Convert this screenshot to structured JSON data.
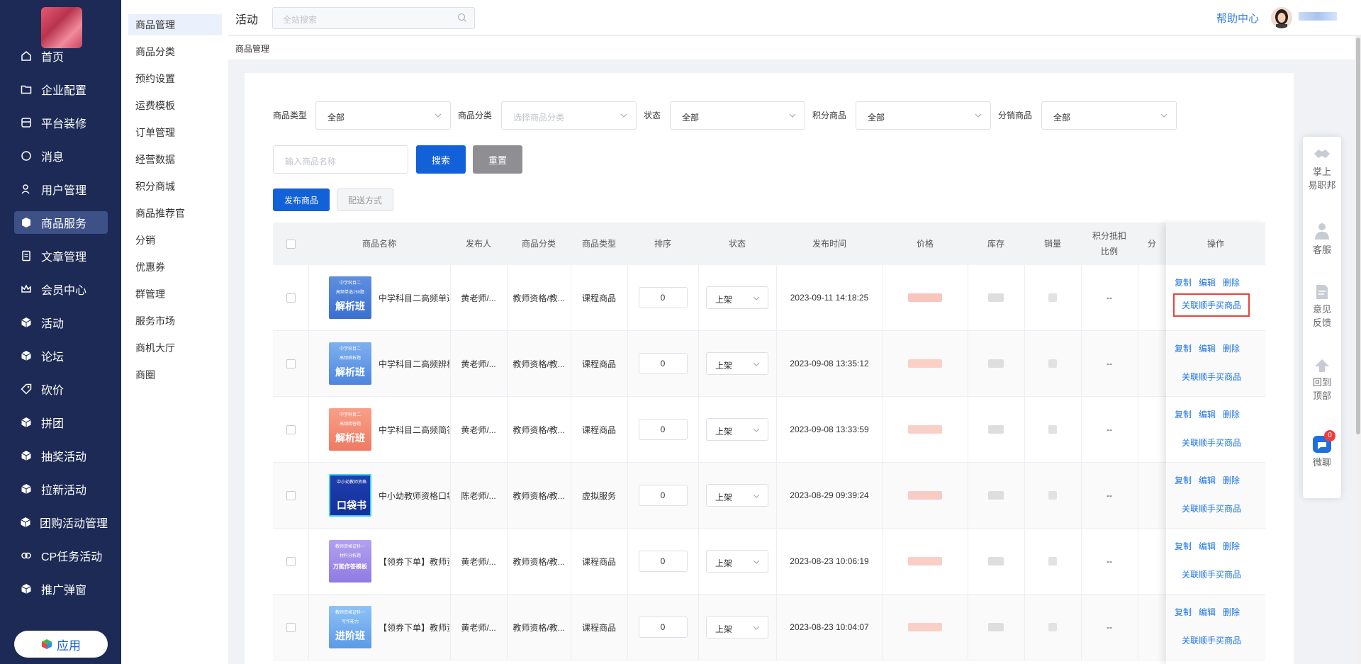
{
  "sidebar": {
    "items": [
      {
        "label": "首页",
        "icon": "home-icon"
      },
      {
        "label": "企业配置",
        "icon": "folder-icon"
      },
      {
        "label": "平台装修",
        "icon": "store-icon"
      },
      {
        "label": "消息",
        "icon": "chat-icon"
      },
      {
        "label": "用户管理",
        "icon": "user-icon"
      },
      {
        "label": "商品服务",
        "icon": "goods-icon",
        "active": true
      },
      {
        "label": "文章管理",
        "icon": "article-icon"
      },
      {
        "label": "会员中心",
        "icon": "crown-icon"
      },
      {
        "label": "活动",
        "icon": "cube-icon"
      },
      {
        "label": "论坛",
        "icon": "cube-icon"
      },
      {
        "label": "砍价",
        "icon": "tag-icon"
      },
      {
        "label": "拼团",
        "icon": "cube-icon"
      },
      {
        "label": "抽奖活动",
        "icon": "cube-icon"
      },
      {
        "label": "拉新活动",
        "icon": "cube-icon"
      },
      {
        "label": "团购活动管理",
        "icon": "cube-icon"
      },
      {
        "label": "CP任务活动",
        "icon": "link-icon"
      },
      {
        "label": "推广弹窗",
        "icon": "cube-icon"
      }
    ],
    "app_button": "应用"
  },
  "subnav": {
    "items": [
      "商品管理",
      "商品分类",
      "预约设置",
      "运费模板",
      "订单管理",
      "经营数据",
      "积分商城",
      "商品推荐官",
      "分销",
      "优惠券",
      "群管理",
      "服务市场",
      "商机大厅",
      "商圈"
    ]
  },
  "topbar": {
    "title": "活动",
    "search_placeholder": "全站搜索",
    "help": "帮助中心"
  },
  "breadcrumb": "商品管理",
  "filters": {
    "type_label": "商品类型",
    "type_value": "全部",
    "category_label": "商品分类",
    "category_placeholder": "选择商品分类",
    "status_label": "状态",
    "status_value": "全部",
    "points_label": "积分商品",
    "points_value": "全部",
    "distrib_label": "分销商品",
    "distrib_value": "全部",
    "name_placeholder": "输入商品名称",
    "search_btn": "搜索",
    "reset_btn": "重置",
    "publish_btn": "发布商品",
    "delivery_btn": "配送方式"
  },
  "table": {
    "headers": {
      "name": "商品名称",
      "publisher": "发布人",
      "category": "商品分类",
      "type": "商品类型",
      "sort": "排序",
      "status": "状态",
      "time": "发布时间",
      "price": "价格",
      "stock": "库存",
      "sales": "销量",
      "points_1": "积分抵扣",
      "points_2": "比例",
      "distrib": "分",
      "ops": "操作"
    },
    "ops": {
      "copy": "复制",
      "edit": "编辑",
      "delete": "删除",
      "assoc": "关联顺手买商品"
    },
    "rows": [
      {
        "name": "中学科目二高频单选",
        "thumb_top": "中学科目二",
        "thumb_mid": "高频单选150题",
        "thumb_big": "解析班",
        "publisher": "黄老师/...",
        "category": "教师资格/教...",
        "type": "课程商品",
        "sort": "0",
        "status": "上架",
        "time": "2023-09-11 14:18:25",
        "points": "--"
      },
      {
        "name": "中学科目二高频辨析",
        "thumb_top": "中学科目二",
        "thumb_mid": "高频辨析题",
        "thumb_big": "解析班",
        "publisher": "黄老师/...",
        "category": "教师资格/教...",
        "type": "课程商品",
        "sort": "0",
        "status": "上架",
        "time": "2023-09-08 13:35:12",
        "points": "--"
      },
      {
        "name": "中学科目二高频简答",
        "thumb_top": "中学科目二",
        "thumb_mid": "高频简答题",
        "thumb_big": "解析班",
        "publisher": "黄老师/...",
        "category": "教师资格/教...",
        "type": "课程商品",
        "sort": "0",
        "status": "上架",
        "time": "2023-09-08 13:33:59",
        "points": "--"
      },
      {
        "name": "中小幼教师资格口袋书",
        "thumb_top": "中小幼教师资格",
        "thumb_mid": "",
        "thumb_big": "口袋书",
        "publisher": "陈老师/...",
        "category": "教师资格/教...",
        "type": "虚拟服务",
        "sort": "0",
        "status": "上架",
        "time": "2023-08-29 09:39:24",
        "points": "--"
      },
      {
        "name": "【领券下单】教师资格",
        "thumb_top": "教师资格证科一",
        "thumb_mid": "材料分析题",
        "thumb_big": "万能作答模板",
        "publisher": "黄老师/...",
        "category": "教师资格/教...",
        "type": "课程商品",
        "sort": "0",
        "status": "上架",
        "time": "2023-08-23 10:06:19",
        "points": "--"
      },
      {
        "name": "【领券下单】教师资格",
        "thumb_top": "教师资格证科一",
        "thumb_mid": "写作能力",
        "thumb_big": "进阶班",
        "publisher": "黄老师/...",
        "category": "教师资格/教...",
        "type": "课程商品",
        "sort": "0",
        "status": "上架",
        "time": "2023-08-23 10:04:07",
        "points": "--"
      }
    ]
  },
  "float_panel": {
    "zhangshang": "掌上",
    "yizhibang": "易职邦",
    "service": "客服",
    "feedback_1": "意见",
    "feedback_2": "反馈",
    "top_1": "回到",
    "top_2": "顶部",
    "chat": "微聊",
    "chat_badge": "0"
  }
}
